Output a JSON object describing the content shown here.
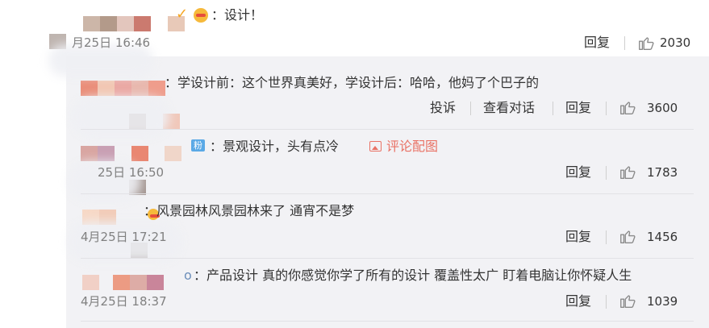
{
  "comments": [
    {
      "text": "：设计！",
      "time": "月25日 16:46",
      "reply": "回复",
      "likes": "2030"
    },
    {
      "text": "：学设计前：这个世界真美好，学设计后：哈哈，他妈了个巴子的",
      "report": "投诉",
      "view_conversation": "查看对话",
      "reply": "回复",
      "likes": "3600"
    },
    {
      "badge": "粉",
      "text": "：景观设计，头有点冷",
      "pic_link": "评论配图",
      "time": "25日 16:50",
      "reply": "回复",
      "likes": "1783"
    },
    {
      "text": "：风景园林风景园林来了  通宵不是梦",
      "time": "4月25日 17:21",
      "reply": "回复",
      "likes": "1456"
    },
    {
      "text": "：产品设计 真的你感觉你学了所有的设计  覆盖性太广 盯着电脑让你怀疑人生",
      "name_tail": "o",
      "time": "4月25日 18:37",
      "reply": "回复",
      "likes": "1039"
    }
  ],
  "colors": {
    "panel_bg": "#f2f2f5",
    "link_red": "#e97265",
    "time_gray": "#808080"
  }
}
